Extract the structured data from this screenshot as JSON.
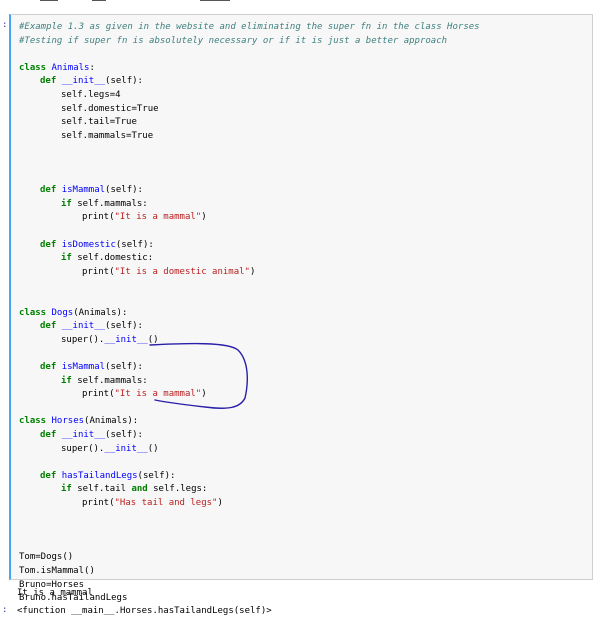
{
  "cell": {
    "prompt": ":",
    "lines": [
      {
        "indent": 0,
        "parts": [
          {
            "t": "#Example 1.3 as given in the website and eliminating the super fn in the class Horses",
            "c": "c"
          }
        ]
      },
      {
        "indent": 0,
        "parts": [
          {
            "t": "#Testing if super fn is absolutely necessary or if it is just a better approach",
            "c": "c"
          }
        ]
      },
      {
        "indent": 0,
        "parts": []
      },
      {
        "indent": 0,
        "parts": [
          {
            "t": "class ",
            "c": "k"
          },
          {
            "t": "Animals",
            "c": "nc"
          },
          {
            "t": ":",
            "c": "n"
          }
        ]
      },
      {
        "indent": 1,
        "parts": [
          {
            "t": "def ",
            "c": "k"
          },
          {
            "t": "__init__",
            "c": "fn"
          },
          {
            "t": "(self):",
            "c": "n"
          }
        ]
      },
      {
        "indent": 2,
        "parts": [
          {
            "t": "self.legs=4",
            "c": "n"
          }
        ]
      },
      {
        "indent": 2,
        "parts": [
          {
            "t": "self.domestic=True",
            "c": "n"
          }
        ]
      },
      {
        "indent": 2,
        "parts": [
          {
            "t": "self.tail=True",
            "c": "n"
          }
        ]
      },
      {
        "indent": 2,
        "parts": [
          {
            "t": "self.mammals=True",
            "c": "n"
          }
        ]
      },
      {
        "indent": 0,
        "parts": []
      },
      {
        "indent": 0,
        "parts": []
      },
      {
        "indent": 0,
        "parts": []
      },
      {
        "indent": 1,
        "parts": [
          {
            "t": "def ",
            "c": "k"
          },
          {
            "t": "isMammal",
            "c": "fn"
          },
          {
            "t": "(self):",
            "c": "n"
          }
        ]
      },
      {
        "indent": 2,
        "parts": [
          {
            "t": "if ",
            "c": "k"
          },
          {
            "t": "self.mammals:",
            "c": "n"
          }
        ]
      },
      {
        "indent": 3,
        "parts": [
          {
            "t": "print(",
            "c": "n"
          },
          {
            "t": "\"It is a mammal\"",
            "c": "s"
          },
          {
            "t": ")",
            "c": "n"
          }
        ]
      },
      {
        "indent": 0,
        "parts": []
      },
      {
        "indent": 1,
        "parts": [
          {
            "t": "def ",
            "c": "k"
          },
          {
            "t": "isDomestic",
            "c": "fn"
          },
          {
            "t": "(self):",
            "c": "n"
          }
        ]
      },
      {
        "indent": 2,
        "parts": [
          {
            "t": "if ",
            "c": "k"
          },
          {
            "t": "self.domestic:",
            "c": "n"
          }
        ]
      },
      {
        "indent": 3,
        "parts": [
          {
            "t": "print(",
            "c": "n"
          },
          {
            "t": "\"It is a domestic animal\"",
            "c": "s"
          },
          {
            "t": ")",
            "c": "n"
          }
        ]
      },
      {
        "indent": 0,
        "parts": []
      },
      {
        "indent": 0,
        "parts": []
      },
      {
        "indent": 0,
        "parts": [
          {
            "t": "class ",
            "c": "k"
          },
          {
            "t": "Dogs",
            "c": "nc"
          },
          {
            "t": "(Animals):",
            "c": "n"
          }
        ]
      },
      {
        "indent": 1,
        "parts": [
          {
            "t": "def ",
            "c": "k"
          },
          {
            "t": "__init__",
            "c": "fn"
          },
          {
            "t": "(self):",
            "c": "n"
          }
        ]
      },
      {
        "indent": 2,
        "parts": [
          {
            "t": "super().",
            "c": "n"
          },
          {
            "t": "__init__",
            "c": "fn"
          },
          {
            "t": "()",
            "c": "n"
          }
        ]
      },
      {
        "indent": 0,
        "parts": []
      },
      {
        "indent": 1,
        "parts": [
          {
            "t": "def ",
            "c": "k"
          },
          {
            "t": "isMammal",
            "c": "fn"
          },
          {
            "t": "(self):",
            "c": "n"
          }
        ]
      },
      {
        "indent": 2,
        "parts": [
          {
            "t": "if ",
            "c": "k"
          },
          {
            "t": "self.mammals:",
            "c": "n"
          }
        ]
      },
      {
        "indent": 3,
        "parts": [
          {
            "t": "print(",
            "c": "n"
          },
          {
            "t": "\"It is a mammal\"",
            "c": "s"
          },
          {
            "t": ")",
            "c": "n"
          }
        ]
      },
      {
        "indent": 0,
        "parts": []
      },
      {
        "indent": 0,
        "parts": [
          {
            "t": "class ",
            "c": "k"
          },
          {
            "t": "Horses",
            "c": "nc"
          },
          {
            "t": "(Animals):",
            "c": "n"
          }
        ]
      },
      {
        "indent": 1,
        "parts": [
          {
            "t": "def ",
            "c": "k"
          },
          {
            "t": "__init__",
            "c": "fn"
          },
          {
            "t": "(self):",
            "c": "n"
          }
        ]
      },
      {
        "indent": 2,
        "parts": [
          {
            "t": "super().",
            "c": "n"
          },
          {
            "t": "__init__",
            "c": "fn"
          },
          {
            "t": "()",
            "c": "n"
          }
        ]
      },
      {
        "indent": 0,
        "parts": []
      },
      {
        "indent": 1,
        "parts": [
          {
            "t": "def ",
            "c": "k"
          },
          {
            "t": "hasTailandLegs",
            "c": "fn"
          },
          {
            "t": "(self):",
            "c": "n"
          }
        ]
      },
      {
        "indent": 2,
        "parts": [
          {
            "t": "if ",
            "c": "k"
          },
          {
            "t": "self.tail ",
            "c": "n"
          },
          {
            "t": "and ",
            "c": "k"
          },
          {
            "t": "self.legs:",
            "c": "n"
          }
        ]
      },
      {
        "indent": 3,
        "parts": [
          {
            "t": "print(",
            "c": "n"
          },
          {
            "t": "\"Has tail and legs\"",
            "c": "s"
          },
          {
            "t": ")",
            "c": "n"
          }
        ]
      },
      {
        "indent": 0,
        "parts": []
      },
      {
        "indent": 0,
        "parts": []
      },
      {
        "indent": 0,
        "parts": []
      },
      {
        "indent": 0,
        "parts": [
          {
            "t": "Tom=Dogs()",
            "c": "n"
          }
        ]
      },
      {
        "indent": 0,
        "parts": [
          {
            "t": "Tom.isMammal()",
            "c": "n"
          }
        ]
      },
      {
        "indent": 0,
        "parts": [
          {
            "t": "Bruno=Horses",
            "c": "n"
          }
        ]
      },
      {
        "indent": 0,
        "parts": [
          {
            "t": "Bruno.hasTailandLegs",
            "c": "n"
          }
        ]
      }
    ]
  },
  "output": {
    "stdout": "It is a mammal",
    "result_prompt": ":",
    "result": "<function __main__.Horses.hasTailandLegs(self)>"
  },
  "colors": {
    "cell_border_accent": "#42a5f5",
    "annotation_ink": "#2a1fa8",
    "keyword": "#008000",
    "class_name": "#0000ff",
    "string": "#ba2121",
    "comment": "#408080"
  }
}
